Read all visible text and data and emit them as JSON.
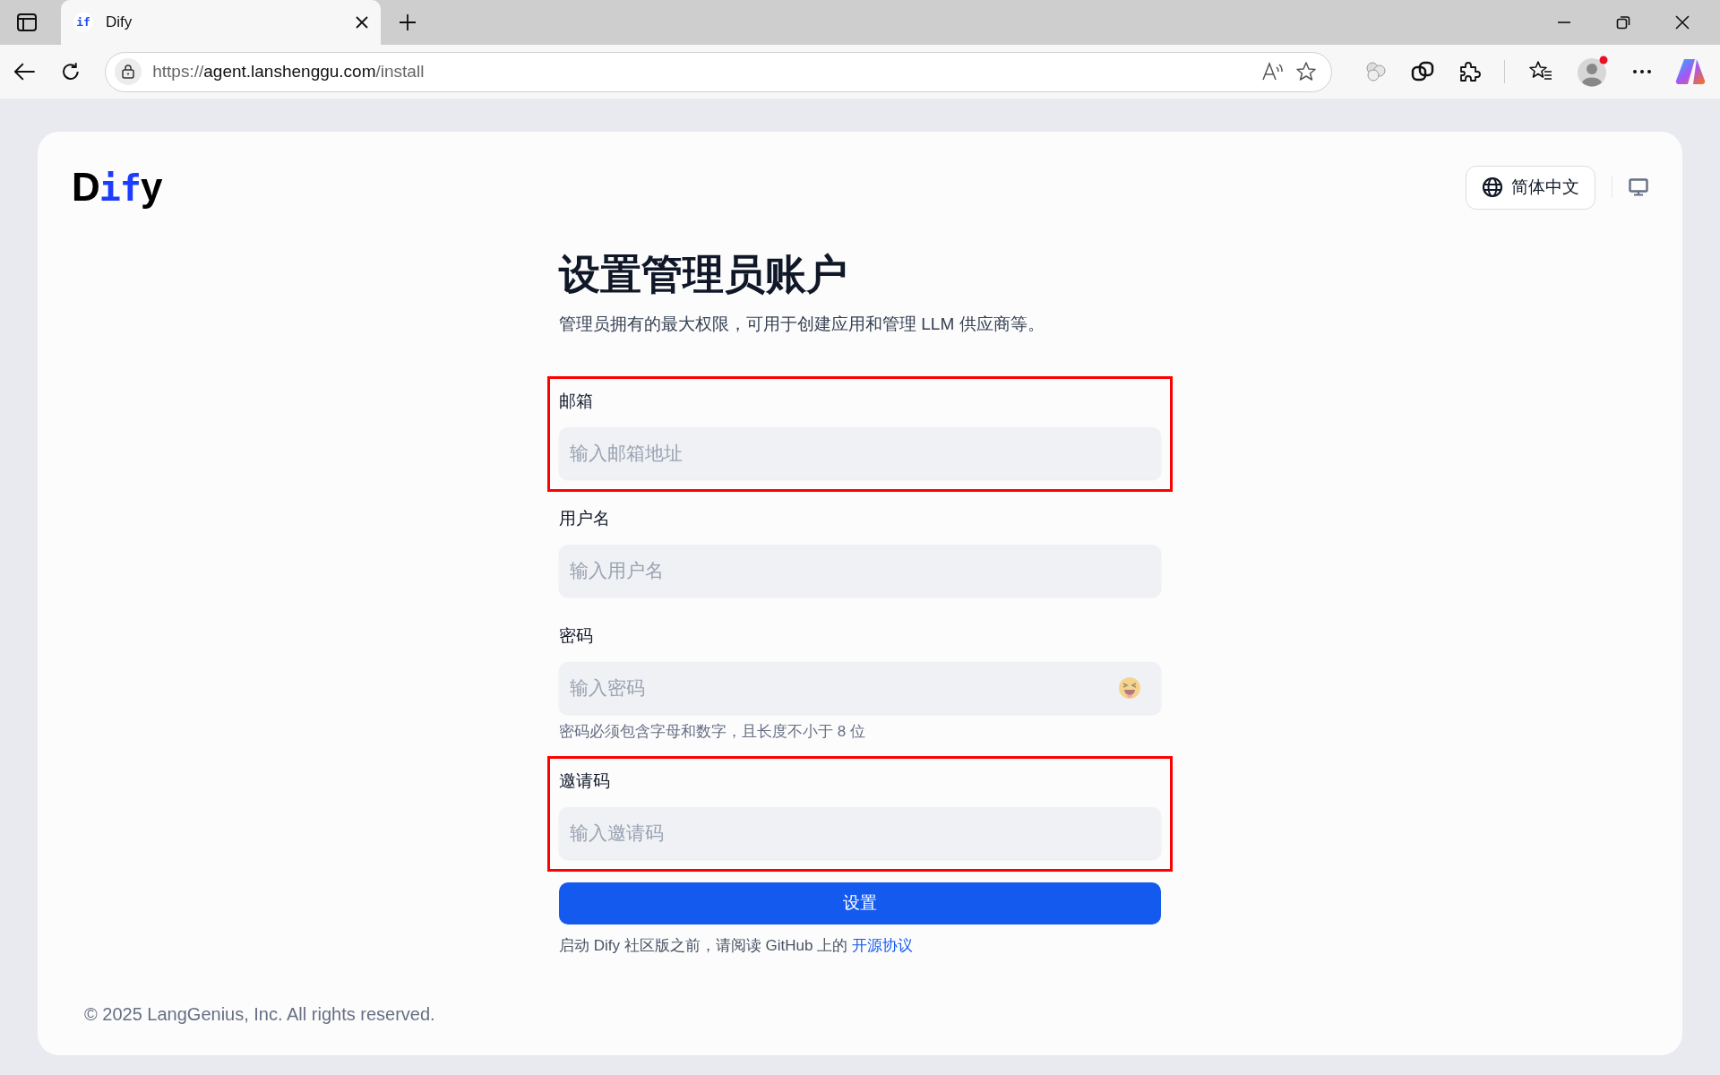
{
  "browser": {
    "tab_title": "Dify",
    "tab_favicon": "if",
    "url": {
      "scheme": "https://",
      "host": "agent.lanshenggu.com",
      "path": "/install"
    }
  },
  "logo": {
    "start": "D",
    "middle": "if",
    "end": "y"
  },
  "language_button": "简体中文",
  "title": "设置管理员账户",
  "subtitle": "管理员拥有的最大权限，可用于创建应用和管理 LLM 供应商等。",
  "fields": [
    {
      "kind": "text",
      "label": "邮箱",
      "placeholder": "输入邮箱地址",
      "highlighted": true
    },
    {
      "kind": "text",
      "label": "用户名",
      "placeholder": "输入用户名",
      "highlighted": false
    },
    {
      "kind": "password",
      "label": "密码",
      "placeholder": "输入密码",
      "hint": "密码必须包含字母和数字，且长度不小于 8 位",
      "highlighted": false
    },
    {
      "kind": "text",
      "label": "邀请码",
      "placeholder": "输入邀请码",
      "highlighted": true
    }
  ],
  "submit_button": "设置",
  "agreement": {
    "text": "启动 Dify 社区版之前，请阅读 GitHub 上的",
    "link": "开源协议"
  },
  "footer": "© 2025 LangGenius, Inc. All rights reserved."
}
